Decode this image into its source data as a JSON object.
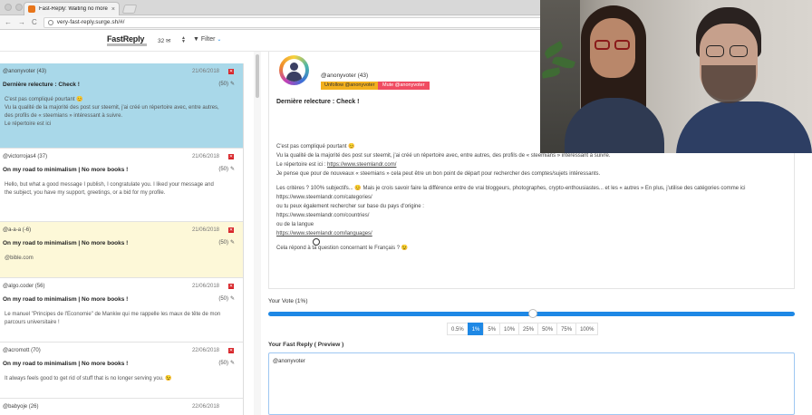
{
  "browser": {
    "tab_title": "Fast-Reply: Waiting no more",
    "tab_close": "×",
    "url": "very-fast-reply.surge.sh/#/",
    "nav_back": "←",
    "nav_forward": "→",
    "nav_reload": "C"
  },
  "header": {
    "logo": "FastReply",
    "count": "32",
    "count_icon": "inbox-icon",
    "updown": "▲▼",
    "filter_label": "Filter",
    "filter_icon": "funnel-icon"
  },
  "list": {
    "items": [
      {
        "author": "@anonyvoter (43)",
        "date": "21/06/2018",
        "title": "Dernière relecture : Check !",
        "count": "(50)",
        "body": "C'est pas compliqué pourtant 😊\nVu la qualité de la majorité des post sur steemit, j'ai créé un répertoire avec, entre autres, des profils de « steemians » intéressant à suivre.\nLe répertoire est ici",
        "bg": "#a9d8e9"
      },
      {
        "author": "@victorrojas4 (37)",
        "date": "21/06/2018",
        "title": "On my road to minimalism | No more books !",
        "count": "(50)",
        "body": "Hello, but what a good message I publish, I congratulate you. I liked your message and the subject, you have my support, greetings, or a bid for my profile.",
        "bg": "#ffffff"
      },
      {
        "author": "@a-a-a (-6)",
        "date": "21/06/2018",
        "title": "On my road to minimalism | No more books !",
        "count": "(50)",
        "body": "@bible.com",
        "bg": "#fdf8d8"
      },
      {
        "author": "@algo.coder (56)",
        "date": "21/06/2018",
        "title": "On my road to minimalism | No more books !",
        "count": "(50)",
        "body": "Le manuel \"Principes de l'Economie\" de Mankiw qui me rappelle les maux de tête de mon parcours universitaire !",
        "bg": "#ffffff"
      },
      {
        "author": "@acromott (70)",
        "date": "22/06/2018",
        "title": "On my road to minimalism | No more books !",
        "count": "(50)",
        "body": "It always feels good to get rid of stuff that is no longer serving you. 😉",
        "bg": "#ffffff"
      },
      {
        "author": "@babyoje (26)",
        "date": "22/06/2018",
        "title": "",
        "count": "",
        "body": "",
        "bg": "#ffffff"
      }
    ]
  },
  "detail": {
    "author": "@anonyvoter (43)",
    "unfollow_label": "Unfollow @anonyvoter",
    "mute_label": "Mute @anonyvoter",
    "title": "Dernière relecture : Check !",
    "body": {
      "p1": "C'est pas compliqué pourtant 😊",
      "p2": "Vu la qualité de la majorité des post sur steemit, j'ai créé un répertoire avec, entre autres, des profils de « steemians » intéressant à suivre.",
      "p3_prefix": "Le répertoire est ici : ",
      "p3_link": "https://www.steemlandr.com/",
      "p4": "Je pense que pour de nouveaux « steemians » cela peut être un bon point de départ pour rechercher des comptes/sujets intéressants.",
      "p5": "Les critères ? 100% subjectifs... 😊 Mais je crois savoir faire la différence entre de vrai bloggeurs, photographes, crypto-enthousiastes... et les « autres » En plus, j'utilise des catégories comme ici",
      "p6": "https://www.steemlandr.com/categories/",
      "p7": "ou tu peux également rechercher sur base du pays d'origine :",
      "p8": "https://www.steemlandr.com/countries/",
      "p9": "ou de la langue",
      "p10_link": "https://www.steemlandr.com/languages/",
      "p11": "Cela répond à ta question concernant le Français ? 😉"
    }
  },
  "vote": {
    "label": "Your Vote (1%)",
    "level_percent": 1,
    "options": [
      "0.5%",
      "1%",
      "5%",
      "10%",
      "25%",
      "50%",
      "75%",
      "100%"
    ],
    "active_index": 1,
    "accent": "#1e88e5"
  },
  "reply": {
    "label": "Your Fast Reply ( Preview )",
    "value": "@anonyvoter"
  }
}
